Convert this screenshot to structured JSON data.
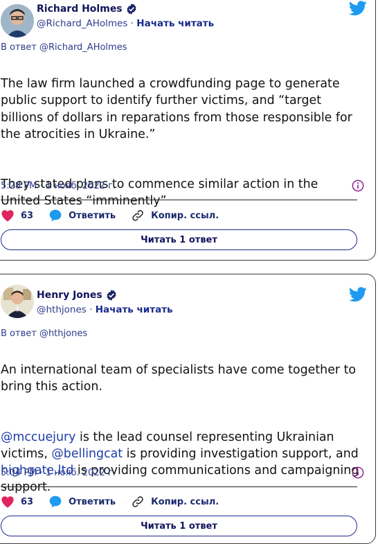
{
  "tweets": [
    {
      "author_name": "Richard Holmes",
      "handle": "@Richard_AHolmes",
      "separator": " · ",
      "follow_label": "Начать читать",
      "reply_to": "В ответ @Richard_AHolmes",
      "paragraph1": "The law firm launched a crowdfunding page to generate public support to identify further victims, and “target billions of dollars in reparations from those responsible for the atrocities in Ukraine.”",
      "paragraph2": "They stated plans to commence similar action in the United States “imminently”",
      "timestamp": "5:28 PM · 1 нояб. 2022 г.",
      "likes": "63",
      "reply_label": "Ответить",
      "copy_label": "Копир. ссыл.",
      "read_replies_label": "Читать 1 ответ"
    },
    {
      "author_name": "Henry Jones",
      "handle": "@hthjones",
      "separator": " · ",
      "follow_label": "Начать читать",
      "reply_to": "В ответ @hthjones",
      "paragraph1": "An international team of specialists have come together to bring this action.",
      "mention1": "@mccuejury",
      "text_a": " is the lead counsel representing Ukrainian victims, ",
      "mention2": "@bellingcat",
      "text_b": " is providing investigation support, and ",
      "link1": "highgate.ltd",
      "text_c": " is providing communications and campaigning support.",
      "timestamp": "5:04 PM · 1 нояб. 2022 г.",
      "likes": "63",
      "reply_label": "Ответить",
      "copy_label": "Копир. ссыл.",
      "read_replies_label": "Читать 1 ответ"
    }
  ],
  "colors": {
    "like": "#e0245e",
    "reply": "#1d9bf0",
    "bird": "#1d9bf0",
    "link": "#1d3ca8",
    "info": "#8a1c8c"
  },
  "icons": [
    "verified-badge-icon",
    "twitter-bird-icon",
    "heart-icon",
    "reply-bubble-icon",
    "link-icon",
    "info-icon"
  ]
}
